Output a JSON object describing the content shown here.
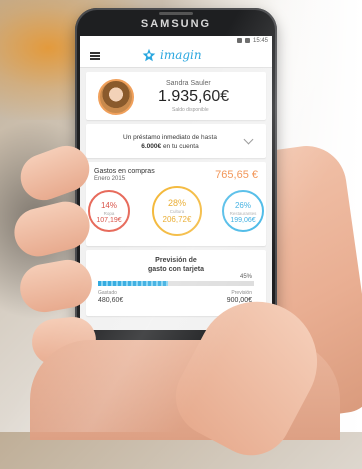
{
  "phone": {
    "brand": "SAMSUNG",
    "status_time": "15:45"
  },
  "app": {
    "logo_text": "imagin",
    "icons": {
      "menu": "hamburger-menu-icon",
      "logo": "star-logo-icon",
      "loan_expand": "chevron-down-icon"
    }
  },
  "profile": {
    "name": "Sandra Sauler",
    "balance": "1.935,60€",
    "balance_label": "Saldo disponible"
  },
  "loan": {
    "line1": "Un préstamo inmediato de hasta",
    "amount": "6.000€",
    "line2_suffix": " en tu cuenta"
  },
  "expenses": {
    "title": "Gastos en compras",
    "period": "Enero 2015",
    "total": "765,65 €",
    "categories": [
      {
        "pct": "14%",
        "label": "Ropa",
        "amount": "107,19€",
        "color": "#e76b5c"
      },
      {
        "pct": "28%",
        "label": "Cultura",
        "amount": "206,72€",
        "color": "#f3b531"
      },
      {
        "pct": "26%",
        "label": "Restaurantes",
        "amount": "199,06€",
        "color": "#41b6e6"
      }
    ]
  },
  "forecast": {
    "title_line1": "Previsión de",
    "title_line2": "gasto con tarjeta",
    "percent_label": "45%",
    "progress": 0.45,
    "spent_label": "Gastado",
    "spent_value": "480,60€",
    "forecast_label": "Previsión",
    "forecast_value": "900,00€"
  },
  "colors": {
    "brand_blue": "#2aa7df",
    "accent_orange": "#f0833a"
  }
}
